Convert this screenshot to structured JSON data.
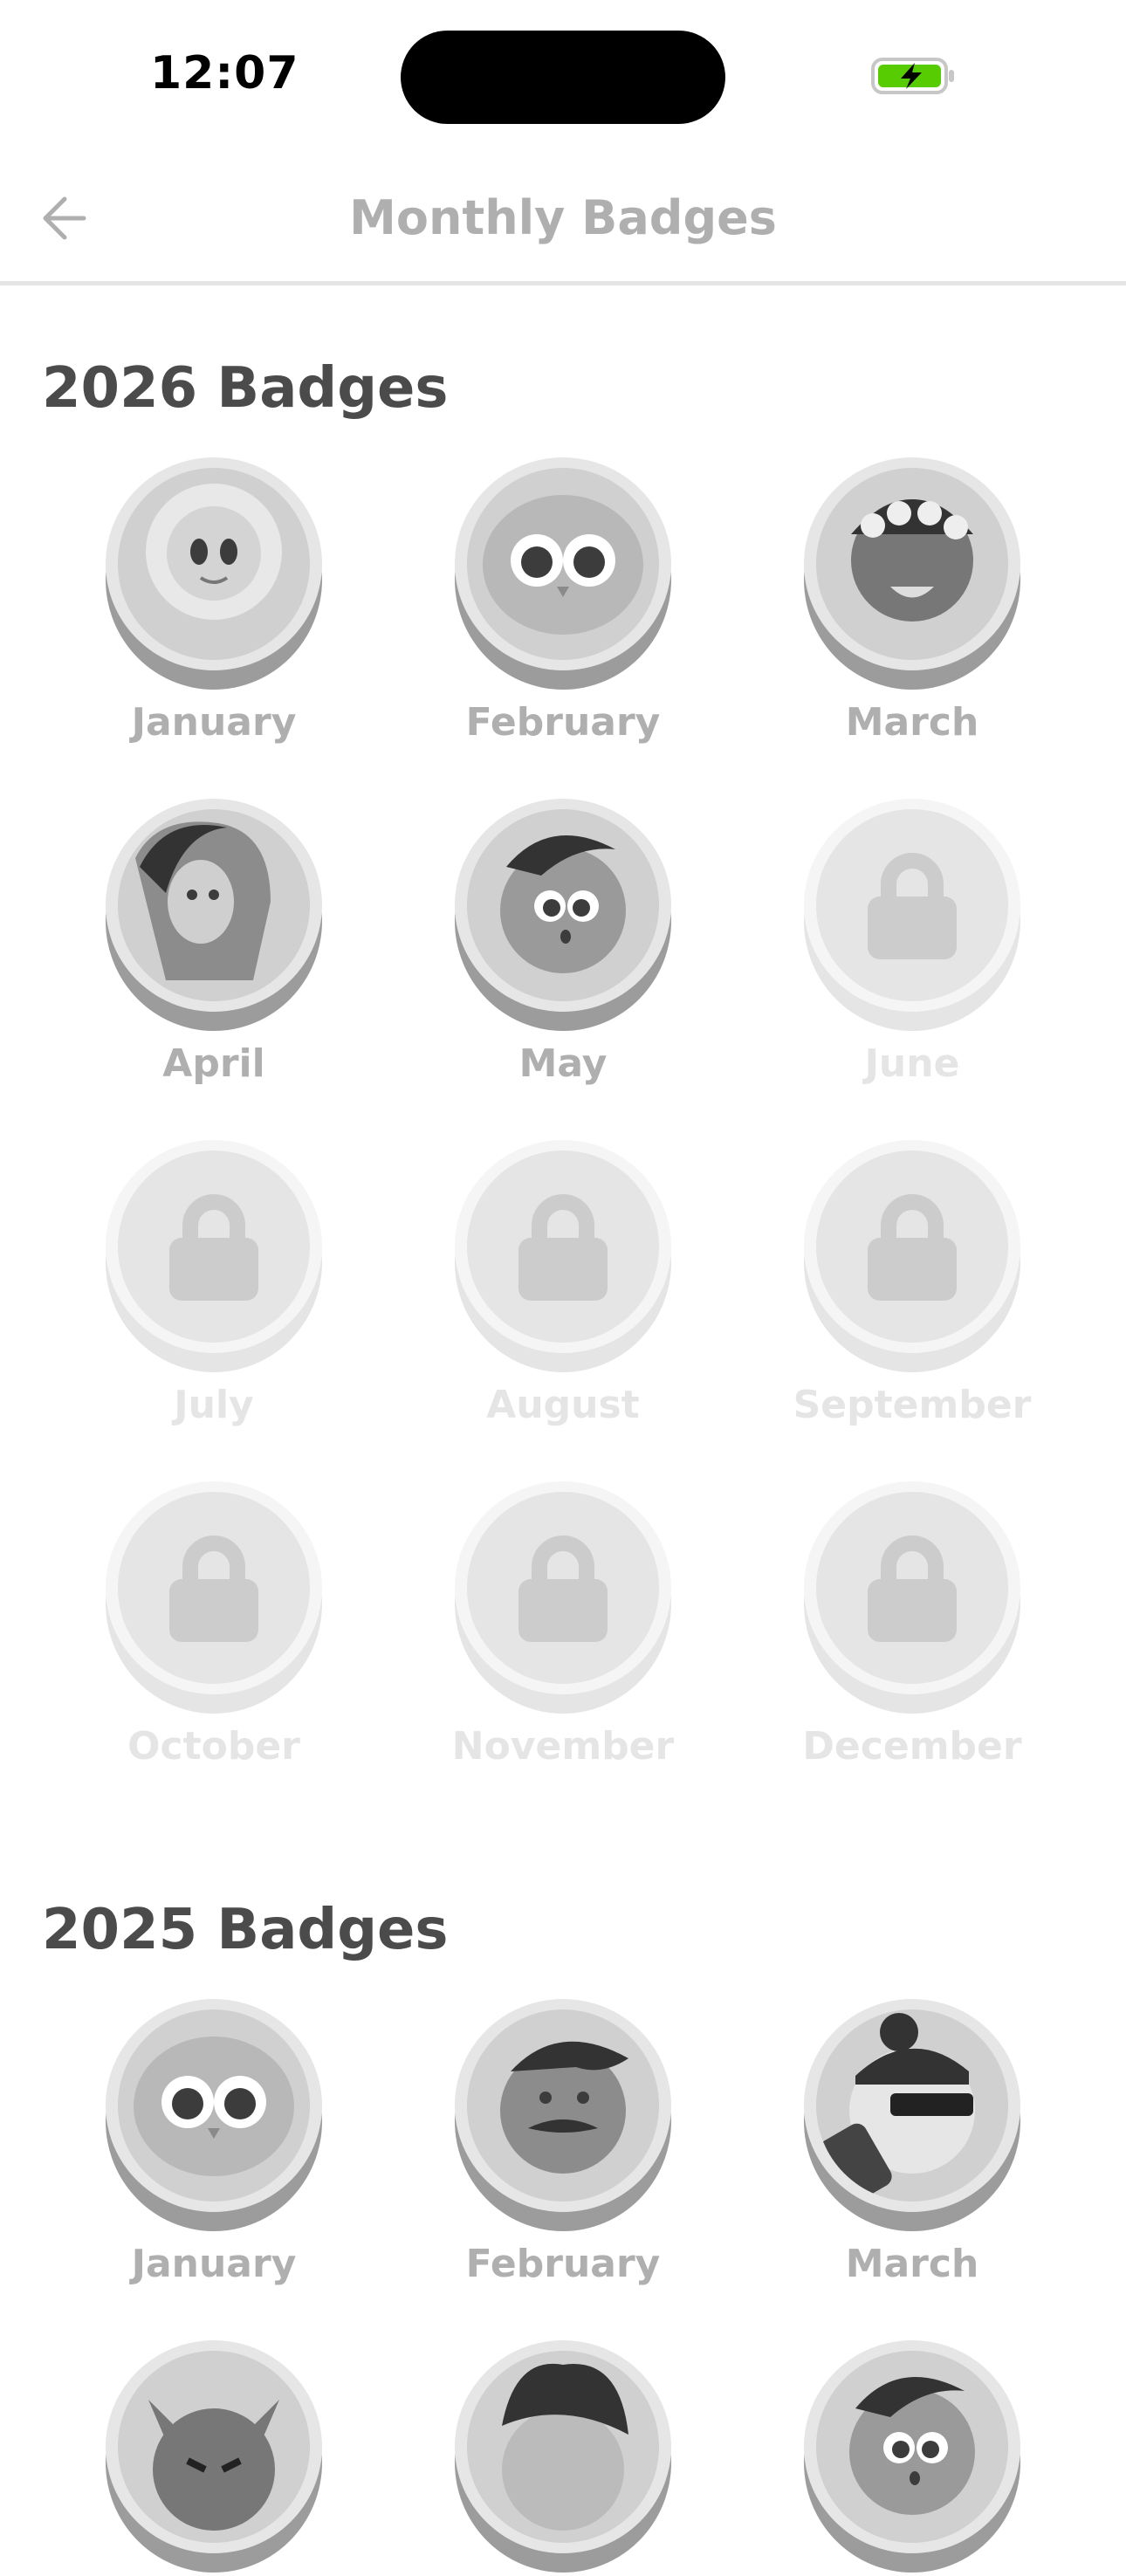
{
  "status": {
    "time": "12:07"
  },
  "header": {
    "title": "Monthly Badges"
  },
  "sections": [
    {
      "title": "2026 Badges",
      "badges": [
        {
          "month": "January",
          "locked": false,
          "icon": "lion-character"
        },
        {
          "month": "February",
          "locked": false,
          "icon": "owl-character"
        },
        {
          "month": "March",
          "locked": false,
          "icon": "flower-crown-character"
        },
        {
          "month": "April",
          "locked": false,
          "icon": "woman-character"
        },
        {
          "month": "May",
          "locked": false,
          "icon": "boy-character"
        },
        {
          "month": "June",
          "locked": true,
          "icon": "lock-icon"
        },
        {
          "month": "July",
          "locked": true,
          "icon": "lock-icon"
        },
        {
          "month": "August",
          "locked": true,
          "icon": "lock-icon"
        },
        {
          "month": "September",
          "locked": true,
          "icon": "lock-icon"
        },
        {
          "month": "October",
          "locked": true,
          "icon": "lock-icon"
        },
        {
          "month": "November",
          "locked": true,
          "icon": "lock-icon"
        },
        {
          "month": "December",
          "locked": true,
          "icon": "lock-icon"
        }
      ]
    },
    {
      "title": "2025 Badges",
      "badges": [
        {
          "month": "January",
          "locked": false,
          "icon": "owl-character"
        },
        {
          "month": "February",
          "locked": false,
          "icon": "mustache-character"
        },
        {
          "month": "March",
          "locked": false,
          "icon": "sunglasses-character"
        },
        {
          "month": "",
          "locked": false,
          "icon": "cat-character"
        },
        {
          "month": "",
          "locked": false,
          "icon": "curly-hair-character"
        },
        {
          "month": "",
          "locked": false,
          "icon": "boy-character"
        }
      ]
    }
  ],
  "colors": {
    "title": "#afafaf",
    "section": "#4b4b4b",
    "locked_label": "#e5e5e5",
    "battery": "#58cc02"
  }
}
